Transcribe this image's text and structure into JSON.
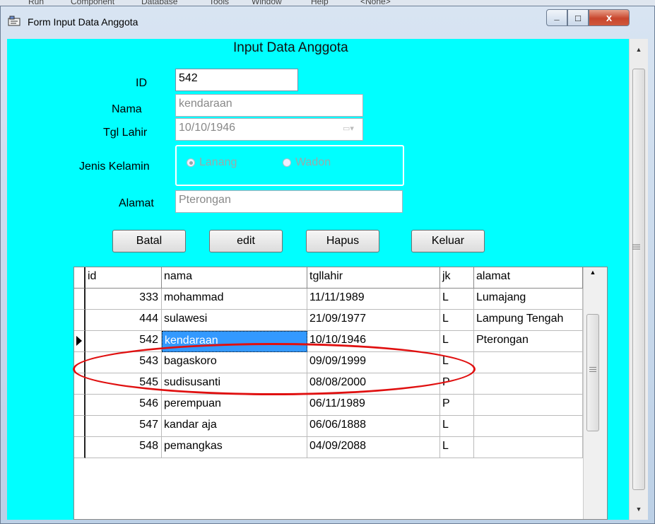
{
  "ide_menu": [
    "Run",
    "Component",
    "Database",
    "Tools",
    "Window",
    "Help",
    "<None>"
  ],
  "window": {
    "title": "Form Input Data Anggota",
    "close_glyph": "x",
    "min_glyph": "_",
    "max_glyph": "□"
  },
  "form": {
    "heading": "Input Data Anggota",
    "id_label": "ID",
    "id_value": "542",
    "nama_label": "Nama",
    "nama_value": "kendaraan",
    "tgl_label": "Tgl Lahir",
    "tgl_value": "10/10/1946",
    "jk_label": "Jenis Kelamin",
    "radio_lanang": "Lanang",
    "radio_wadon": "Wadon",
    "alamat_label": "Alamat",
    "alamat_value": "Pterongan"
  },
  "buttons": {
    "batal": "Batal",
    "edit": "edit",
    "hapus": "Hapus",
    "keluar": "Keluar"
  },
  "grid": {
    "columns": [
      "id",
      "nama",
      "tgllahir",
      "jk",
      "alamat"
    ],
    "rows": [
      {
        "id": "333",
        "nama": "mohammad",
        "tgllahir": "11/11/1989",
        "jk": "L",
        "alamat": "Lumajang"
      },
      {
        "id": "444",
        "nama": "sulawesi",
        "tgllahir": "21/09/1977",
        "jk": "L",
        "alamat": "Lampung Tengah"
      },
      {
        "id": "542",
        "nama": "kendaraan",
        "tgllahir": "10/10/1946",
        "jk": "L",
        "alamat": "Pterongan"
      },
      {
        "id": "543",
        "nama": "bagaskoro",
        "tgllahir": "09/09/1999",
        "jk": "L",
        "alamat": ""
      },
      {
        "id": "545",
        "nama": "sudisusanti",
        "tgllahir": "08/08/2000",
        "jk": "P",
        "alamat": ""
      },
      {
        "id": "546",
        "nama": "perempuan",
        "tgllahir": "06/11/1989",
        "jk": "P",
        "alamat": ""
      },
      {
        "id": "547",
        "nama": "kandar aja",
        "tgllahir": "06/06/1888",
        "jk": "L",
        "alamat": ""
      },
      {
        "id": "548",
        "nama": "pemangkas",
        "tgllahir": "04/09/2088",
        "jk": "L",
        "alamat": ""
      }
    ]
  },
  "colors": {
    "client_bg": "#00ffff",
    "selection": "#3399ff",
    "highlight_ellipse": "#e01010"
  }
}
